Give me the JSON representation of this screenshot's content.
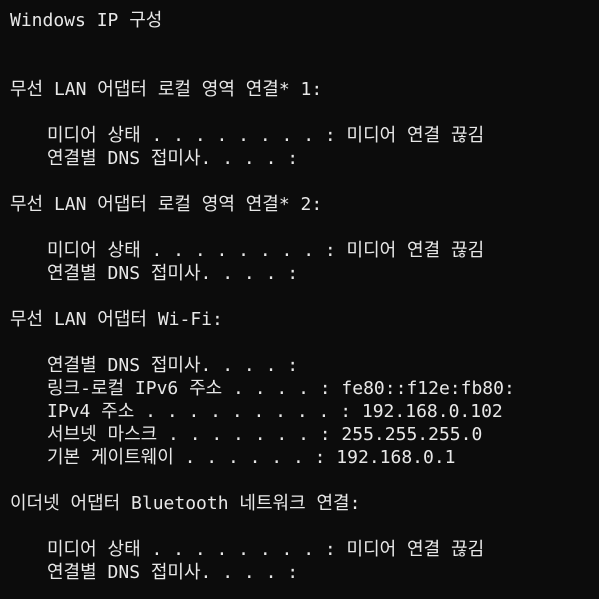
{
  "title": "Windows IP 구성",
  "adapters": [
    {
      "header": "무선 LAN 어댑터 로컬 영역 연결* 1:",
      "rows": [
        "미디어 상태 . . . . . . . . : 미디어 연결 끊김",
        "연결별 DNS 접미사. . . . :"
      ]
    },
    {
      "header": "무선 LAN 어댑터 로컬 영역 연결* 2:",
      "rows": [
        "미디어 상태 . . . . . . . . : 미디어 연결 끊김",
        "연결별 DNS 접미사. . . . :"
      ]
    },
    {
      "header": "무선 LAN 어댑터 Wi-Fi:",
      "rows": [
        "연결별 DNS 접미사. . . . :",
        "링크-로컬 IPv6 주소 . . . . : fe80::f12e:fb80:",
        "IPv4 주소 . . . . . . . . . : 192.168.0.102",
        "서브넷 마스크 . . . . . . . : 255.255.255.0",
        "기본 게이트웨이 . . . . . . : 192.168.0.1"
      ]
    },
    {
      "header": "이더넷 어댑터 Bluetooth 네트워크 연결:",
      "rows": [
        "미디어 상태 . . . . . . . . : 미디어 연결 끊김",
        "연결별 DNS 접미사. . . . :"
      ]
    }
  ]
}
